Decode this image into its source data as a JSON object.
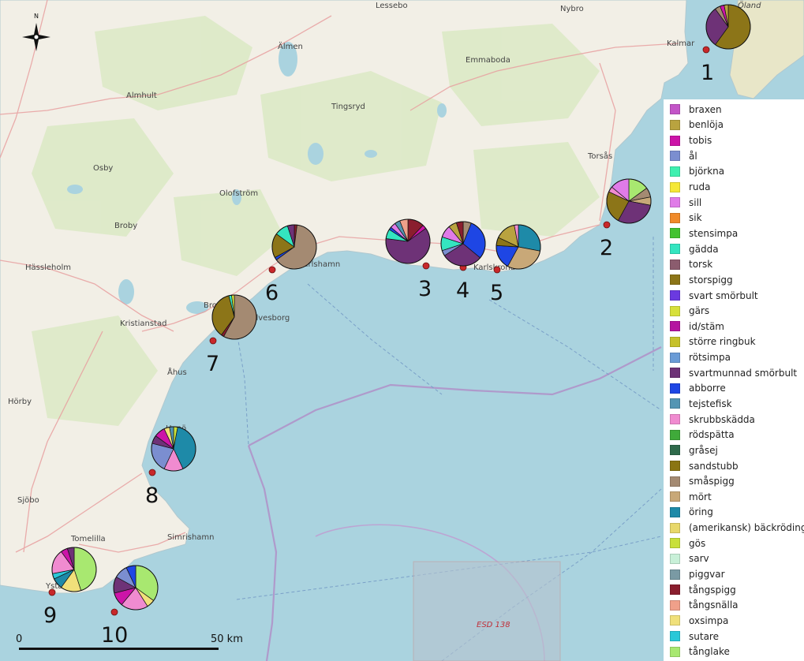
{
  "map": {
    "places": [
      "Lessebo",
      "Nybro",
      "Öland",
      "Kalmar",
      "Emmaboda",
      "Älmen",
      "Almhult",
      "Tingsryd",
      "Torsås",
      "Osby",
      "Olofström",
      "Broby",
      "Hässleholm",
      "Karlshamn",
      "Karlskrona",
      "Kristianstad",
      "Åhus",
      "Hörby",
      "Hanö",
      "Simrishamn",
      "Sjöbo",
      "Tomelilla",
      "Ystad",
      "Bromölla",
      "Sölvesborg"
    ],
    "zone_label": "ESD 138",
    "north_label": "N",
    "scale_start": "0",
    "scale_end": "50 km"
  },
  "legend": [
    {
      "label": "braxen",
      "color": "#c355c8"
    },
    {
      "label": "benlöja",
      "color": "#b9a33f"
    },
    {
      "label": "tobis",
      "color": "#cc14a8"
    },
    {
      "label": "ål",
      "color": "#7b8ed0"
    },
    {
      "label": "björkna",
      "color": "#3ff0b0"
    },
    {
      "label": "ruda",
      "color": "#f5e837"
    },
    {
      "label": "sill",
      "color": "#e07be8"
    },
    {
      "label": "sik",
      "color": "#f08a2a"
    },
    {
      "label": "stensimpa",
      "color": "#43c231"
    },
    {
      "label": "gädda",
      "color": "#34e5c0"
    },
    {
      "label": "torsk",
      "color": "#8b5c6e"
    },
    {
      "label": "storspigg",
      "color": "#8c7518"
    },
    {
      "label": "svart smörbult",
      "color": "#6b3ae0"
    },
    {
      "label": "gärs",
      "color": "#d7e03a"
    },
    {
      "label": "id/stäm",
      "color": "#b514a0"
    },
    {
      "label": "större ringbuk",
      "color": "#c6c12a"
    },
    {
      "label": "rötsimpa",
      "color": "#6a9bd6"
    },
    {
      "label": "svartmunnad smörbult",
      "color": "#6e3277"
    },
    {
      "label": "abborre",
      "color": "#1e46e4"
    },
    {
      "label": "tejstefisk",
      "color": "#5495b3"
    },
    {
      "label": "skrubbskädda",
      "color": "#f08bd0"
    },
    {
      "label": "rödspätta",
      "color": "#3faa3a"
    },
    {
      "label": "gråsej",
      "color": "#2e6a4a"
    },
    {
      "label": "sandstubb",
      "color": "#8a7512"
    },
    {
      "label": "småspigg",
      "color": "#a48a72"
    },
    {
      "label": "mört",
      "color": "#c8a878"
    },
    {
      "label": "öring",
      "color": "#1e8aa8"
    },
    {
      "label": "(amerikansk) bäckröding",
      "color": "#e8d86a"
    },
    {
      "label": "gös",
      "color": "#c8e03a"
    },
    {
      "label": "sarv",
      "color": "#c8f0d8"
    },
    {
      "label": "piggvar",
      "color": "#7a9aa4"
    },
    {
      "label": "tångspigg",
      "color": "#8a1e2e"
    },
    {
      "label": "tångsnälla",
      "color": "#f0a08a"
    },
    {
      "label": "oxsimpa",
      "color": "#f0e07a"
    },
    {
      "label": "sutare",
      "color": "#2ac8d8"
    },
    {
      "label": "tånglake",
      "color": "#a8e870"
    }
  ],
  "stations": [
    {
      "label": "1",
      "slices": [
        {
          "species": "storspigg",
          "value": 60
        },
        {
          "species": "svartmunnad smörbult",
          "value": 30
        },
        {
          "species": "småspigg",
          "value": 4
        },
        {
          "species": "tobis",
          "value": 3
        },
        {
          "species": "benlöja",
          "value": 3
        }
      ]
    },
    {
      "label": "2",
      "slices": [
        {
          "species": "tånglake",
          "value": 15
        },
        {
          "species": "småspigg",
          "value": 7
        },
        {
          "species": "mört",
          "value": 6
        },
        {
          "species": "svartmunnad smörbult",
          "value": 30
        },
        {
          "species": "storspigg",
          "value": 24
        },
        {
          "species": "skrubbskädda",
          "value": 4
        },
        {
          "species": "sill",
          "value": 14
        }
      ]
    },
    {
      "label": "3",
      "slices": [
        {
          "species": "tångspigg",
          "value": 12
        },
        {
          "species": "tobis",
          "value": 3
        },
        {
          "species": "svartmunnad smörbult",
          "value": 62
        },
        {
          "species": "gädda",
          "value": 7
        },
        {
          "species": "abborre",
          "value": 2
        },
        {
          "species": "sill",
          "value": 4
        },
        {
          "species": "tejstefisk",
          "value": 4
        },
        {
          "species": "tångsnälla",
          "value": 6
        }
      ]
    },
    {
      "label": "4",
      "slices": [
        {
          "species": "småspigg",
          "value": 6
        },
        {
          "species": "abborre",
          "value": 30
        },
        {
          "species": "svartmunnad smörbult",
          "value": 30
        },
        {
          "species": "ål",
          "value": 4
        },
        {
          "species": "gädda",
          "value": 10
        },
        {
          "species": "sill",
          "value": 9
        },
        {
          "species": "benlöja",
          "value": 6
        },
        {
          "species": "tångspigg",
          "value": 5
        }
      ]
    },
    {
      "label": "5",
      "slices": [
        {
          "species": "öring",
          "value": 28
        },
        {
          "species": "mört",
          "value": 30
        },
        {
          "species": "abborre",
          "value": 18
        },
        {
          "species": "storspigg",
          "value": 6
        },
        {
          "species": "benlöja",
          "value": 15
        },
        {
          "species": "skrubbskädda",
          "value": 3
        }
      ]
    },
    {
      "label": "6",
      "slices": [
        {
          "species": "tångspigg",
          "value": 2
        },
        {
          "species": "småspigg",
          "value": 63
        },
        {
          "species": "abborre",
          "value": 2
        },
        {
          "species": "storspigg",
          "value": 18
        },
        {
          "species": "gädda",
          "value": 10
        },
        {
          "species": "svartmunnad smörbult",
          "value": 5
        }
      ]
    },
    {
      "label": "7",
      "slices": [
        {
          "species": "småspigg",
          "value": 58
        },
        {
          "species": "tångspigg",
          "value": 2
        },
        {
          "species": "storspigg",
          "value": 36
        },
        {
          "species": "gädda",
          "value": 2
        },
        {
          "species": "gärs",
          "value": 2
        }
      ]
    },
    {
      "label": "8",
      "slices": [
        {
          "species": "gös",
          "value": 3
        },
        {
          "species": "öring",
          "value": 40
        },
        {
          "species": "skrubbskädda",
          "value": 14
        },
        {
          "species": "ål",
          "value": 22
        },
        {
          "species": "svartmunnad smörbult",
          "value": 6
        },
        {
          "species": "tobis",
          "value": 8
        },
        {
          "species": "oxsimpa",
          "value": 4
        },
        {
          "species": "tejstefisk",
          "value": 3
        }
      ]
    },
    {
      "label": "9",
      "slices": [
        {
          "species": "tånglake",
          "value": 45
        },
        {
          "species": "oxsimpa",
          "value": 15
        },
        {
          "species": "öring",
          "value": 8
        },
        {
          "species": "sutare",
          "value": 4
        },
        {
          "species": "skrubbskädda",
          "value": 18
        },
        {
          "species": "tobis",
          "value": 5
        },
        {
          "species": "svartmunnad smörbult",
          "value": 5
        }
      ]
    },
    {
      "label": "10",
      "slices": [
        {
          "species": "tånglake",
          "value": 35
        },
        {
          "species": "oxsimpa",
          "value": 6
        },
        {
          "species": "skrubbskädda",
          "value": 20
        },
        {
          "species": "tobis",
          "value": 10
        },
        {
          "species": "svartmunnad smörbult",
          "value": 12
        },
        {
          "species": "ål",
          "value": 10
        },
        {
          "species": "abborre",
          "value": 7
        }
      ]
    }
  ]
}
